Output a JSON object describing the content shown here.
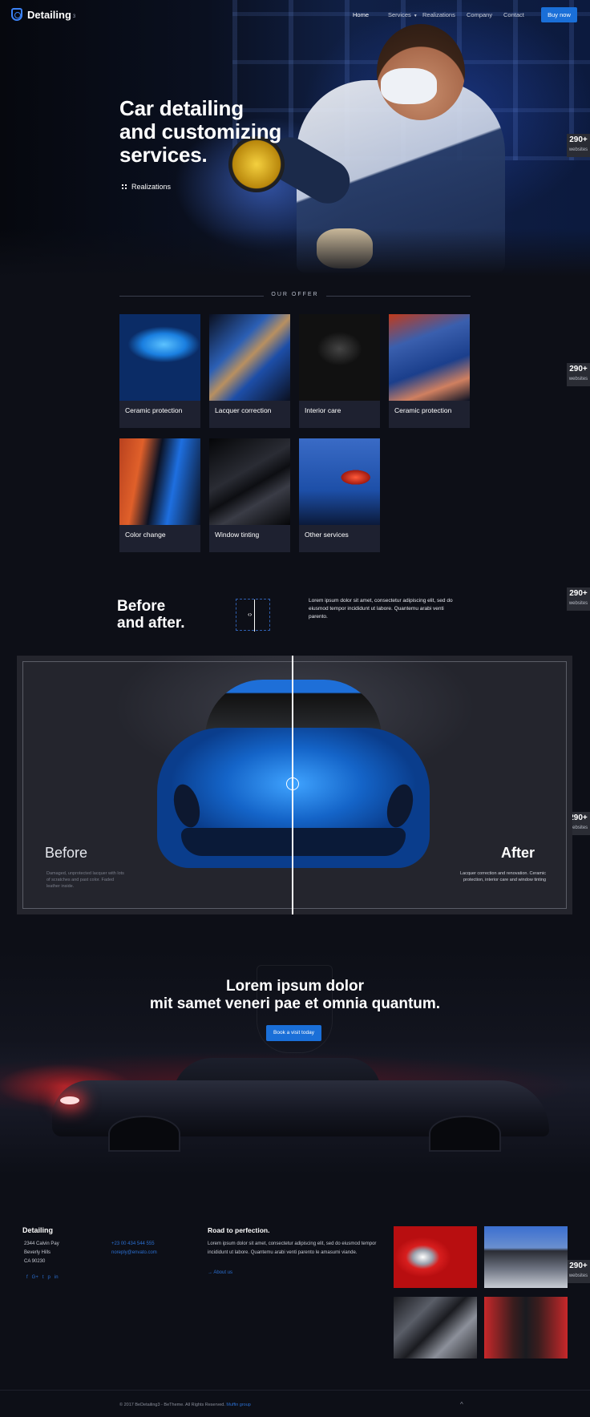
{
  "header": {
    "logo_text": "Detailing",
    "logo_sub": "3",
    "nav": [
      "Home",
      "Services",
      "Realizations",
      "Company",
      "Contact"
    ],
    "buy_label": "Buy now"
  },
  "hero": {
    "title_lines": [
      "Car detailing",
      "and customizing",
      "services."
    ],
    "realizations_label": "Realizations"
  },
  "side_badge": {
    "number": "290+",
    "label": "websites"
  },
  "offer": {
    "heading": "OUR OFFER",
    "cards": [
      "Ceramic protection",
      "Lacquer correction",
      "Interior care",
      "Ceramic protection",
      "Color change",
      "Window tinting",
      "Other services"
    ]
  },
  "before_after": {
    "title_lines": [
      "Before",
      "and after."
    ],
    "text": "Lorem ipsum dolor sit amet, consectetur adipiscing elit, sed do eiusmod tempor incididunt ut labore. Quantemu arabi venti parento.",
    "before_label": "Before",
    "before_text": "Damaged, unprotected lacquer with lots of scratches and past color. Faded leather inside.",
    "after_label": "After",
    "after_text": "Lacquer correction and renovation. Ceramic protection, interior care and window tinting"
  },
  "cta": {
    "title_lines": [
      "Lorem ipsum dolor",
      "mit samet veneri pae et omnia quantum."
    ],
    "button": "Book a visit today"
  },
  "footer": {
    "brand": "Detailing",
    "address": [
      "2344 Calvin Pay",
      "Beverly Hills",
      "CA 90230"
    ],
    "contact": [
      "+23 00 434 544 555",
      "noreply@envato.com"
    ],
    "social": [
      "f",
      "G+",
      "t",
      "p",
      "in"
    ],
    "road_heading": "Road to perfection.",
    "road_text": "Lorem ipsum dolor sit amet, consectetur adipiscing elit, sed do eiusmod tempor incididunt ut labore. Quantemu arabi venti parento le amasumi viande.",
    "about_label": "About us",
    "copyright": "© 2017 BeDetailing3 - BeTheme. All Rights Reserved.",
    "copyright_link": "Muffin group",
    "up_arrow": "^"
  }
}
